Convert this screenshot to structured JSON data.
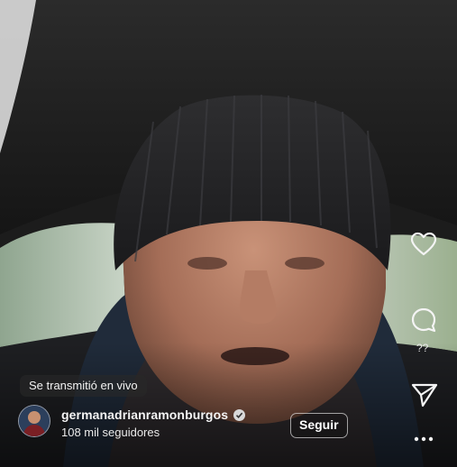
{
  "live_label": "Se transmitió en vivo",
  "user": {
    "username": "germanadrianramonburgos",
    "followers": "108 mil seguidores",
    "verified": true
  },
  "follow_button": "Seguir",
  "side_actions": {
    "comments_count": "??"
  },
  "icons": [
    "heart-icon",
    "comment-icon",
    "send-icon",
    "more-icon",
    "verified-badge-icon"
  ],
  "colors": {
    "overlay": "#282828",
    "text": "#ffffff"
  }
}
